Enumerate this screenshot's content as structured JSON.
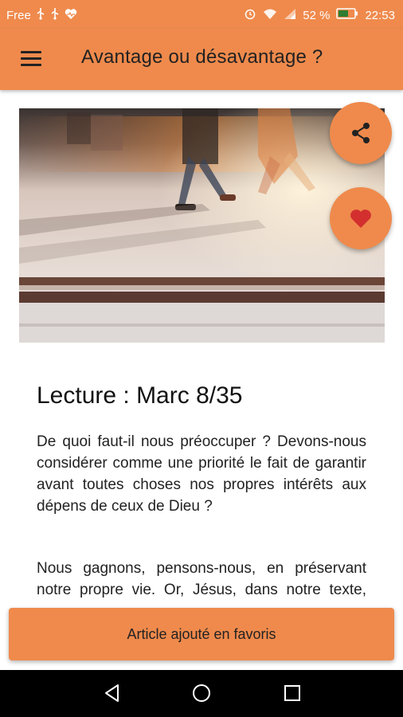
{
  "status_bar": {
    "carrier": "Free",
    "battery": "52 %",
    "time": "22:53"
  },
  "app_bar": {
    "title": "Avantage ou désavantage ?"
  },
  "article": {
    "title": "Lecture : Marc 8/35",
    "paragraph1": "De quoi faut-il nous préoccuper ? Devons-nous considérer comme une priorité le fait de garantir avant toutes choses nos propres intérêts aux dépens de ceux de Dieu ?",
    "paragraph2": "Nous gagnons, pensons-nous, en préservant notre propre vie. Or, Jésus, dans notre texte, nous enseigne une"
  },
  "snackbar": {
    "message": "Article ajouté en favoris"
  },
  "colors": {
    "accent": "#ef8a4c",
    "heart": "#d32f2f"
  },
  "icons": [
    "menu-icon",
    "share-icon",
    "heart-icon",
    "back-icon",
    "home-icon",
    "recents-icon"
  ]
}
